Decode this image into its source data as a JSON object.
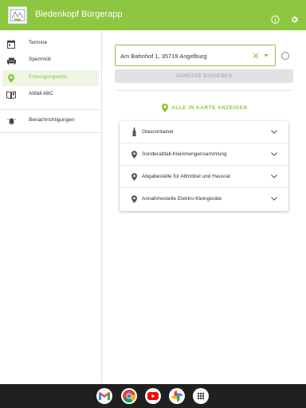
{
  "app": {
    "title": "Biedenkopf Bürgerapp",
    "accent_color": "#8dc641",
    "header_icons": [
      "info-icon",
      "settings-icon"
    ]
  },
  "sidebar": {
    "items": [
      {
        "label": "Termine",
        "icon": "calendar-icon",
        "active": false
      },
      {
        "label": "Sperrmüll",
        "icon": "sofa-icon",
        "active": false
      },
      {
        "label": "Entsorgungsorte",
        "icon": "location-pin-icon",
        "active": true
      },
      {
        "label": "Abfall ABC",
        "icon": "book-icon",
        "active": false
      },
      {
        "label": "Benachrichtigungen",
        "icon": "bell-icon",
        "active": false
      }
    ]
  },
  "main": {
    "address_value": "Am Bahnhof 1, 35719 Angelburg",
    "submit_label": "ADRESSE EINGEBEN",
    "map_link_label": "ALLE IN KARTE ANZEIGEN",
    "locations": [
      {
        "label": "Glascontainer",
        "icon": "bottle-icon"
      },
      {
        "label": "Sonderabfall-Kleinmengensammlung",
        "icon": "location-pin-icon"
      },
      {
        "label": "Abgabestelle für Altmöbel und Hausrat",
        "icon": "location-pin-icon"
      },
      {
        "label": "Annahmestelle Elektro-Kleingeräte",
        "icon": "location-pin-icon"
      }
    ]
  },
  "taskbar": {
    "apps": [
      "gmail-icon",
      "chrome-icon",
      "youtube-icon",
      "photos-icon",
      "app-launcher-icon"
    ]
  }
}
